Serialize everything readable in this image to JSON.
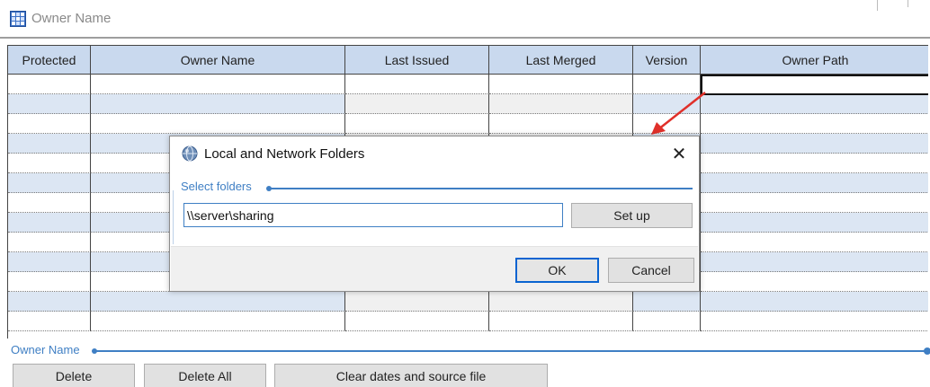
{
  "window": {
    "title": "Owner Name",
    "icon": "grid-app-icon"
  },
  "grid": {
    "columns": [
      "Protected",
      "Owner Name",
      "Last Issued",
      "Last Merged",
      "Version",
      "Owner Path"
    ],
    "row_count": 13
  },
  "owner_group": {
    "label": "Owner Name",
    "buttons": {
      "delete": "Delete",
      "delete_all": "Delete All",
      "clear": "Clear dates and source file"
    }
  },
  "dialog": {
    "title": "Local and Network Folders",
    "icon": "globe-icon",
    "close_icon": "close-icon",
    "group_label": "Select folders",
    "path_value": "\\\\server\\sharing",
    "setup_label": "Set up",
    "ok_label": "OK",
    "cancel_label": "Cancel"
  },
  "colors": {
    "header_bg": "#c9d9ee",
    "alt_row_bg": "#dce6f3",
    "accent": "#3f7fc4",
    "arrow": "#e0302a"
  }
}
